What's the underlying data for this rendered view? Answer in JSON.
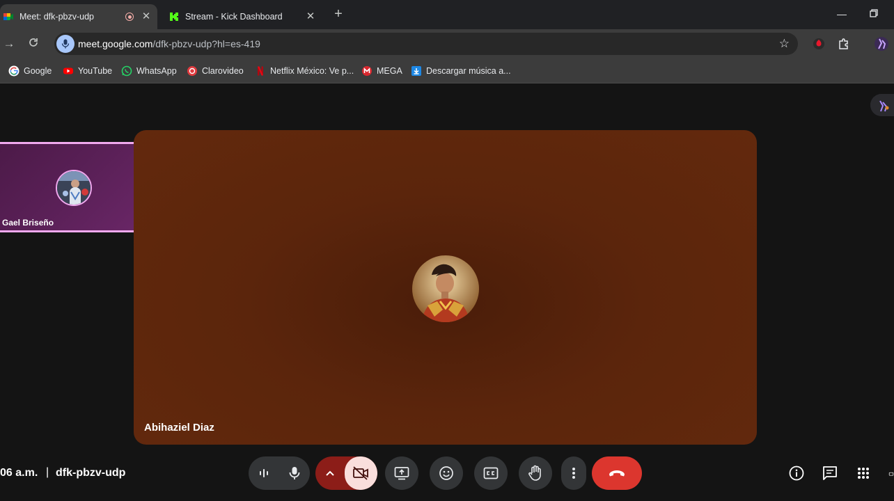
{
  "browser": {
    "tabs": [
      {
        "title": "Meet: dfk-pbzv-udp",
        "active": true,
        "recording": true
      },
      {
        "title": "Stream - Kick Dashboard",
        "active": false
      }
    ],
    "address": {
      "host": "meet.google.com",
      "path": "/dfk-pbzv-udp?hl=es-419"
    },
    "bookmarks": [
      {
        "label": "Google",
        "icon": "google-icon"
      },
      {
        "label": "YouTube",
        "icon": "youtube-icon"
      },
      {
        "label": "WhatsApp",
        "icon": "whatsapp-icon"
      },
      {
        "label": "Clarovideo",
        "icon": "clarovideo-icon"
      },
      {
        "label": "Netflix México: Ve p...",
        "icon": "netflix-icon"
      },
      {
        "label": "MEGA",
        "icon": "mega-icon"
      },
      {
        "label": "Descargar música a...",
        "icon": "download-icon"
      }
    ]
  },
  "meeting": {
    "main_participant": "Abihaziel Diaz",
    "side_participant": "Gael Briseño",
    "time": "06 a.m.",
    "separator": "|",
    "code": "dfk-pbzv-udp",
    "colors": {
      "main_tile": "#5b250c",
      "side_tile": "#5a2057",
      "hangup": "#dc362e",
      "cam_off": "#f9dedc"
    }
  },
  "controls": [
    {
      "name": "audio-level-icon"
    },
    {
      "name": "microphone-icon"
    },
    {
      "name": "camera-options-chevron-icon"
    },
    {
      "name": "camera-off-icon"
    },
    {
      "name": "present-screen-icon"
    },
    {
      "name": "emoji-reaction-icon"
    },
    {
      "name": "captions-icon"
    },
    {
      "name": "raise-hand-icon"
    },
    {
      "name": "more-options-icon"
    },
    {
      "name": "hang-up-icon"
    },
    {
      "name": "meeting-details-icon"
    },
    {
      "name": "chat-icon"
    },
    {
      "name": "activities-icon"
    }
  ]
}
